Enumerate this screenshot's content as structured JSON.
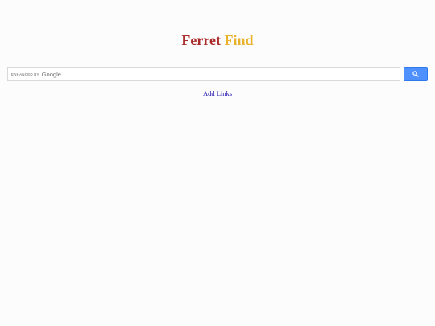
{
  "logo": {
    "word_1": "Ferret",
    "word_2": "Find",
    "word_1_color": "#a92b2b",
    "word_2_color": "#e8b22a"
  },
  "search": {
    "branding_label": "ENHANCED BY",
    "branding_brand": "Google",
    "value": "",
    "button_icon": "search-icon",
    "button_color": "#4d90fe"
  },
  "links": {
    "add_links": "Add Links"
  }
}
